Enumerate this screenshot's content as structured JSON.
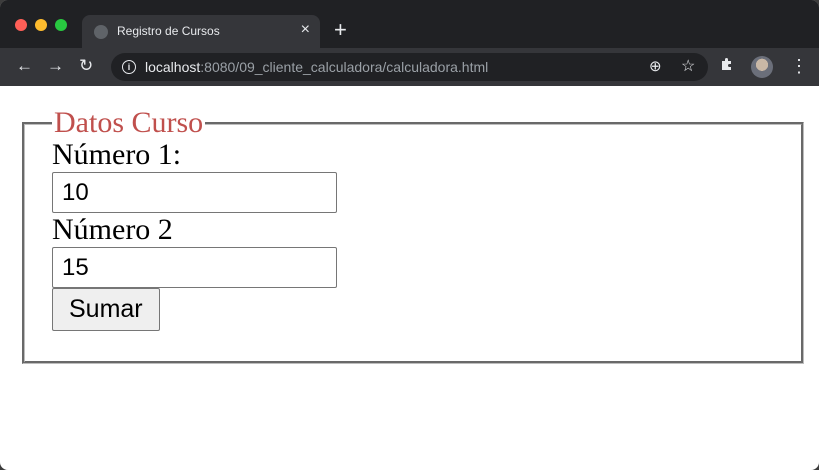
{
  "browser": {
    "tab_title": "Registro de Cursos",
    "tab_close": "×",
    "new_tab": "+",
    "url_host": "localhost",
    "url_rest": ":8080/09_cliente_calculadora/calculadora.html"
  },
  "form": {
    "legend": "Datos Curso",
    "num1_label": "Número 1:",
    "num1_value": "10",
    "num2_label": "Número 2",
    "num2_value": "15",
    "submit_label": "Sumar"
  },
  "colors": {
    "legend": "#c0504d",
    "titlebar": "#202124",
    "toolbar": "#35363a"
  }
}
